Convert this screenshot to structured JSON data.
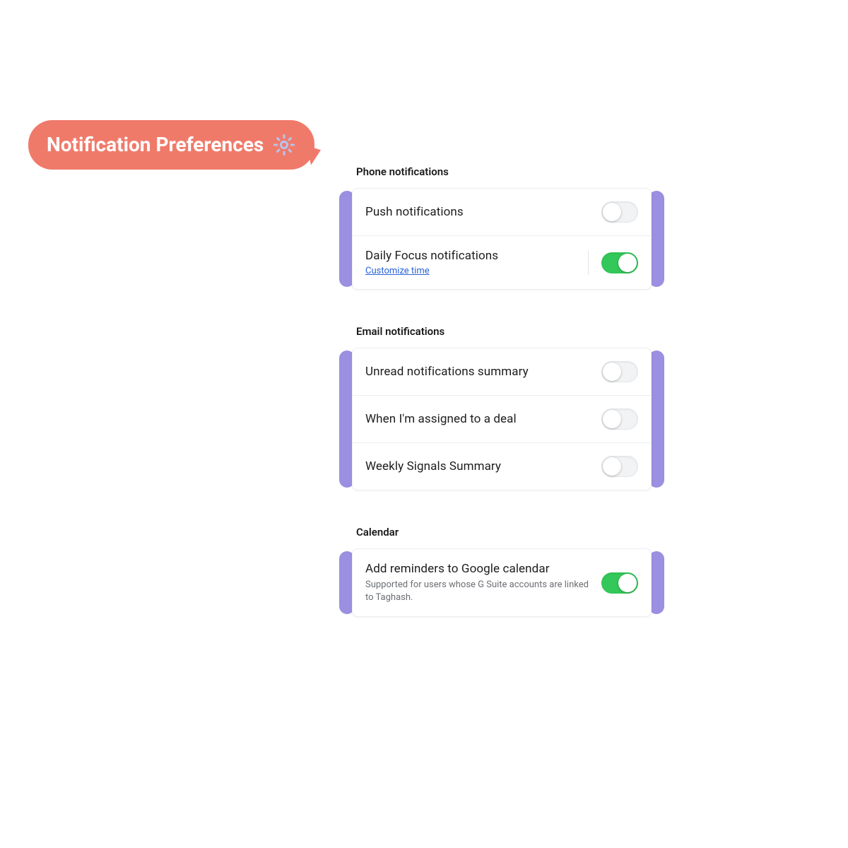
{
  "header": {
    "title": "Notification Preferences",
    "icon": "gear-icon"
  },
  "colors": {
    "bubble": "#f07a6a",
    "accent": "#9a8fe0",
    "toggle_on": "#34c759",
    "link": "#2a62d8"
  },
  "sections": {
    "phone": {
      "label": "Phone notifications",
      "items": {
        "push": {
          "title": "Push notifications",
          "enabled": false
        },
        "daily_focus": {
          "title": "Daily Focus notifications",
          "enabled": true,
          "link_label": "Customize time"
        }
      }
    },
    "email": {
      "label": "Email notifications",
      "items": {
        "unread": {
          "title": "Unread notifications summary",
          "enabled": false
        },
        "assigned": {
          "title": "When I'm assigned to a deal",
          "enabled": false
        },
        "weekly": {
          "title": "Weekly Signals Summary",
          "enabled": false
        }
      }
    },
    "calendar": {
      "label": "Calendar",
      "items": {
        "gcal": {
          "title": "Add reminders to Google calendar",
          "subtitle": "Supported for users whose G Suite accounts are linked to Taghash.",
          "enabled": true
        }
      }
    }
  }
}
